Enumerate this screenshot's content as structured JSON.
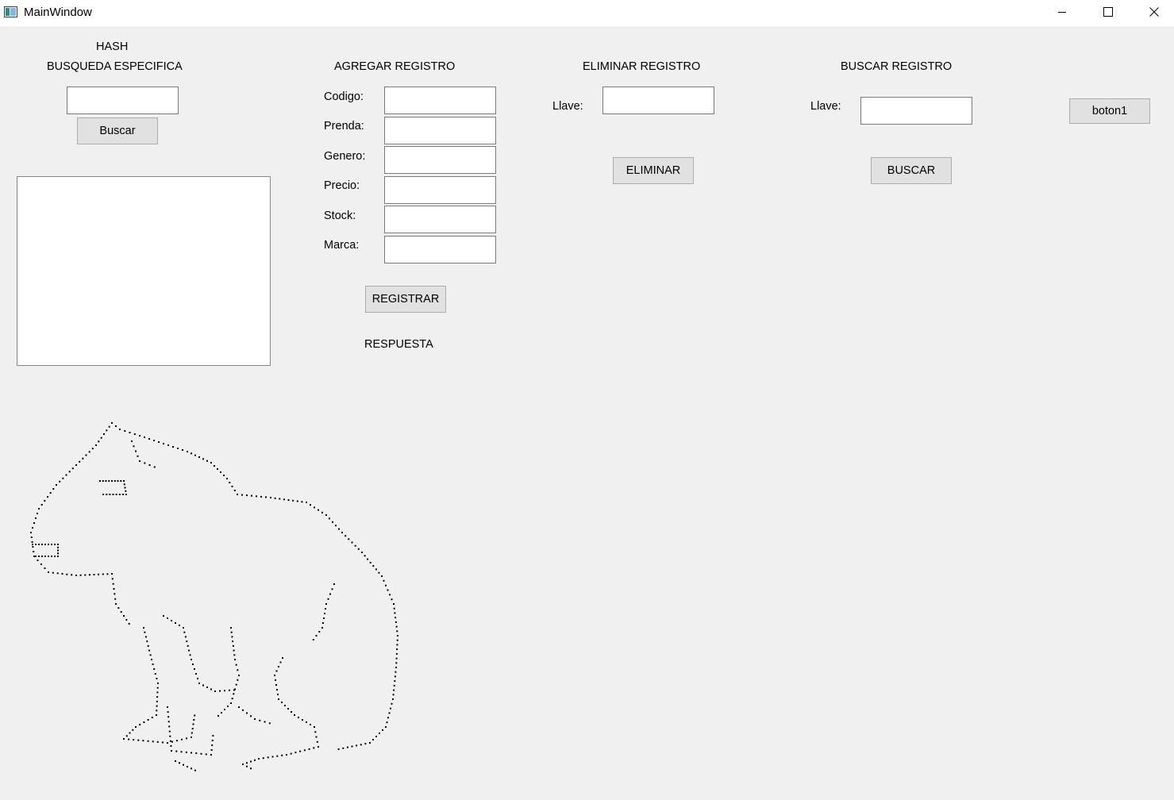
{
  "window": {
    "title": "MainWindow",
    "icon": "app-window-icon"
  },
  "controls": {
    "minimize_icon": "minimize-icon",
    "maximize_icon": "maximize-icon",
    "close_icon": "close-icon"
  },
  "hash": {
    "title": "HASH",
    "subtitle": "BUSQUEDA ESPECIFICA",
    "search_value": "",
    "button_label": "Buscar",
    "list_items": []
  },
  "agregar": {
    "title": "AGREGAR REGISTRO",
    "fields": [
      {
        "label": "Codigo:",
        "value": ""
      },
      {
        "label": "Prenda:",
        "value": ""
      },
      {
        "label": "Genero:",
        "value": ""
      },
      {
        "label": "Precio:",
        "value": ""
      },
      {
        "label": "Stock:",
        "value": ""
      },
      {
        "label": "Marca:",
        "value": ""
      }
    ],
    "button_label": "REGISTRAR",
    "response_label": "RESPUESTA"
  },
  "eliminar": {
    "title": "ELIMINAR REGISTRO",
    "key_label": "Llave:",
    "key_value": "",
    "button_label": "ELIMINAR"
  },
  "buscar": {
    "title": "BUSCAR REGISTRO",
    "key_label": "Llave:",
    "key_value": "",
    "button_label": "BUSCAR"
  },
  "boton1": {
    "label": "boton1"
  },
  "art": {
    "icon": "dotted-dog-drawing"
  }
}
